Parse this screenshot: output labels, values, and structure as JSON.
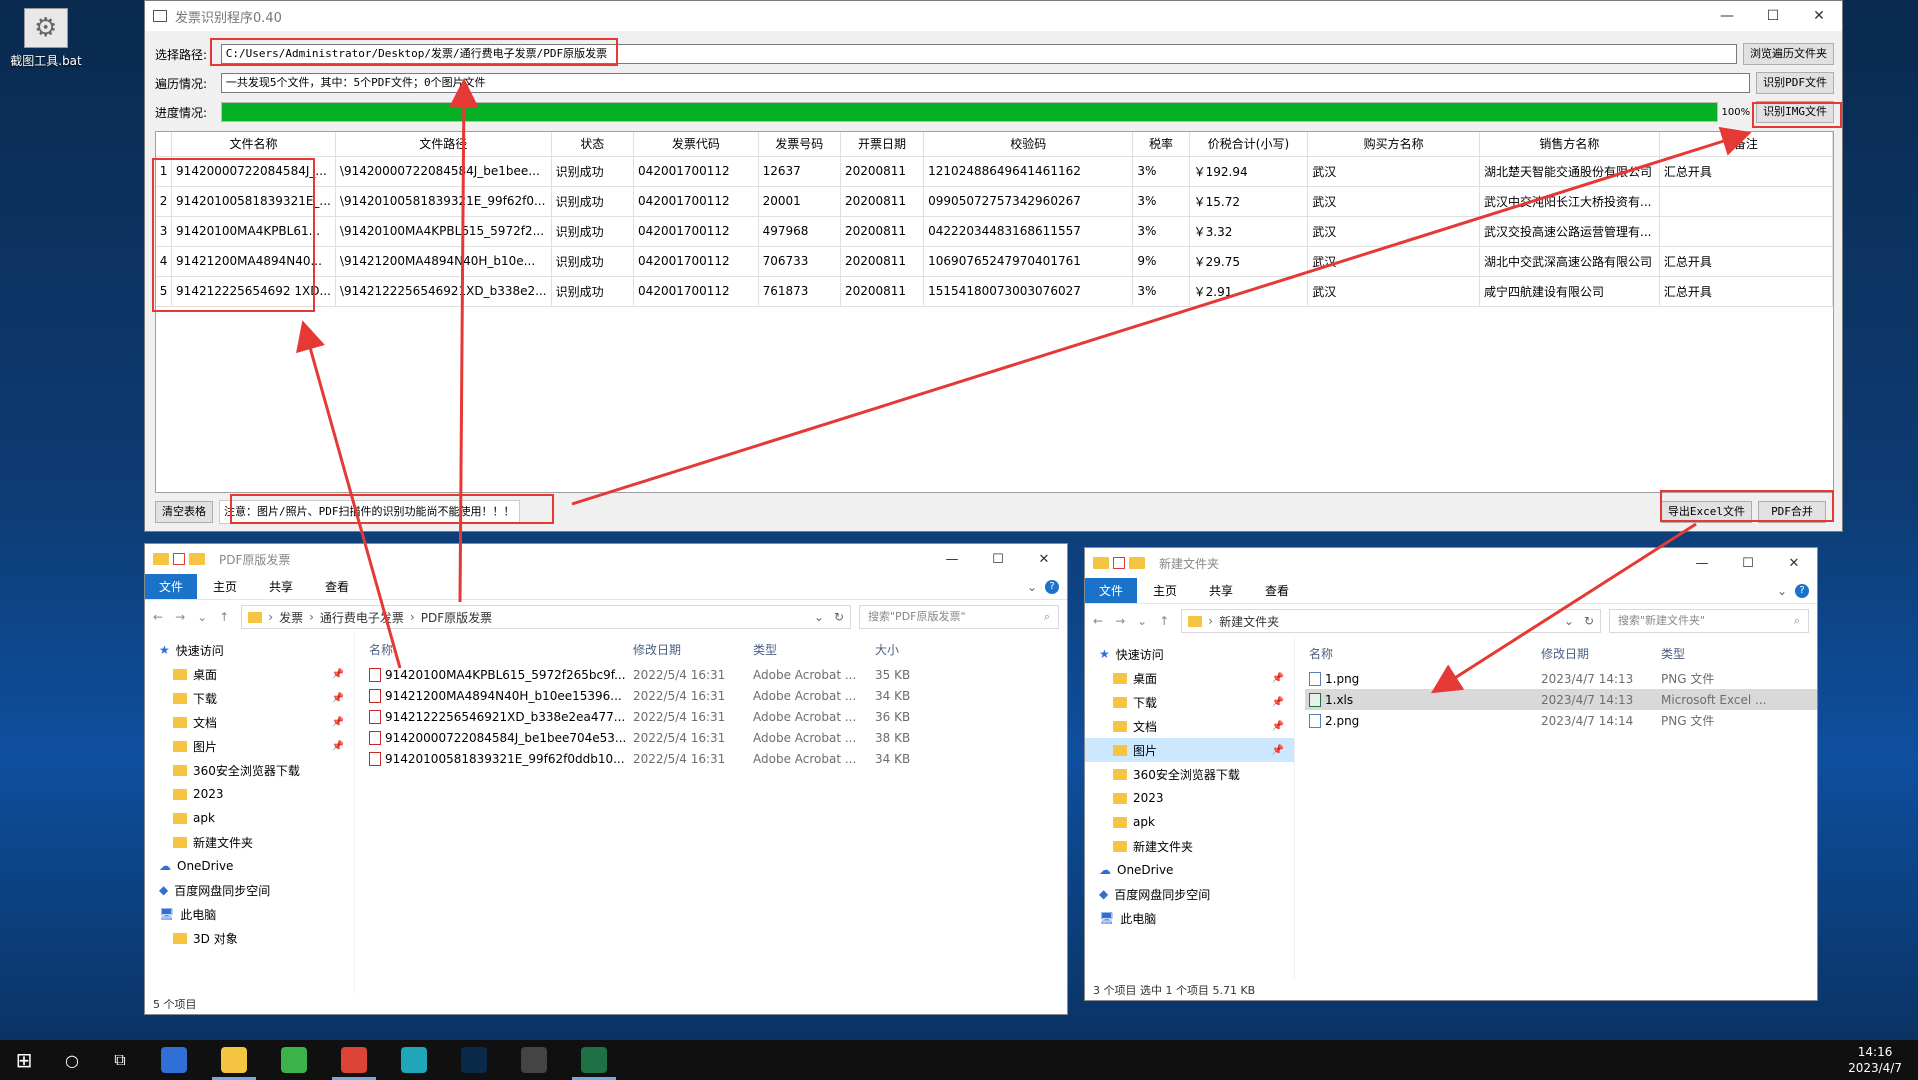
{
  "desktop": {
    "icon_label": "截图工具.bat"
  },
  "app": {
    "title": "发票识别程序0.40",
    "path_label": "选择路径:",
    "path_value": "C:/Users/Administrator/Desktop/发票/通行费电子发票/PDF原版发票",
    "browse_button": "浏览遍历文件夹",
    "scan_label": "遍历情况:",
    "scan_value": "一共发现5个文件，其中：5个PDF文件；0个图片文件",
    "pdf_button": "识别PDF文件",
    "progress_label": "进度情况:",
    "progress_value": 1.0,
    "progress_text": "100%",
    "img_button": "识别IMG文件",
    "columns": [
      "文件名称",
      "文件路径",
      "状态",
      "发票代码",
      "发票号码",
      "开票日期",
      "校验码",
      "税率",
      "价税合计(小写)",
      "购买方名称",
      "销售方名称",
      "备注"
    ],
    "rows": [
      {
        "n": "1",
        "name": "91420000722084584J_...",
        "path": "\\91420000722084584J_be1bee...",
        "status": "识别成功",
        "code": "042001700112",
        "num": "12637",
        "date": "20200811",
        "check": "12102488649641461162",
        "tax": "3%",
        "total": "￥192.94",
        "buyer": "武汉",
        "seller": "湖北楚天智能交通股份有限公司",
        "note": "汇总开具"
      },
      {
        "n": "2",
        "name": "91420100581839321E_...",
        "path": "\\91420100581839321E_99f62f0...",
        "status": "识别成功",
        "code": "042001700112",
        "num": "20001",
        "date": "20200811",
        "check": "09905072757342960267",
        "tax": "3%",
        "total": "￥15.72",
        "buyer": "武汉",
        "seller": "武汉中交沌阳长江大桥投资有...",
        "note": ""
      },
      {
        "n": "3",
        "name": "91420100MA4KPBL61...",
        "path": "\\91420100MA4KPBL615_5972f2...",
        "status": "识别成功",
        "code": "042001700112",
        "num": "497968",
        "date": "20200811",
        "check": "04222034483168611557",
        "tax": "3%",
        "total": "￥3.32",
        "buyer": "武汉",
        "seller": "武汉交投高速公路运营管理有...",
        "note": ""
      },
      {
        "n": "4",
        "name": "91421200MA4894N40...",
        "path": "\\91421200MA4894N40H_b10e...",
        "status": "识别成功",
        "code": "042001700112",
        "num": "706733",
        "date": "20200811",
        "check": "10690765247970401761",
        "tax": "9%",
        "total": "￥29.75",
        "buyer": "武汉",
        "seller": "湖北中交武深高速公路有限公司",
        "note": "汇总开具"
      },
      {
        "n": "5",
        "name": "914212225654692 1XD...",
        "path": "\\9142122256546921XD_b338e2...",
        "status": "识别成功",
        "code": "042001700112",
        "num": "761873",
        "date": "20200811",
        "check": "15154180073003076027",
        "tax": "3%",
        "total": "￥2.91",
        "buyer": "武汉",
        "seller": "咸宁四航建设有限公司",
        "note": "汇总开具"
      }
    ],
    "clear_button": "清空表格",
    "note_text": "注意：图片/照片、PDF扫描件的识别功能尚不能使用！！！",
    "excel_button": "导出Excel文件",
    "merge_button": "PDF合并"
  },
  "explorer1": {
    "title": "PDF原版发票",
    "tabs": [
      "文件",
      "主页",
      "共享",
      "查看"
    ],
    "crumbs": [
      "发票",
      "通行费电子发票",
      "PDF原版发票"
    ],
    "search_placeholder": "搜索\"PDF原版发票\"",
    "nav": [
      {
        "label": "快速访问",
        "head": true
      },
      {
        "label": "桌面",
        "pin": true
      },
      {
        "label": "下载",
        "pin": true
      },
      {
        "label": "文档",
        "pin": true
      },
      {
        "label": "图片",
        "pin": true
      },
      {
        "label": "360安全浏览器下载"
      },
      {
        "label": "2023"
      },
      {
        "label": "apk"
      },
      {
        "label": "新建文件夹"
      },
      {
        "label": "OneDrive",
        "head": true
      },
      {
        "label": "百度网盘同步空间",
        "head": true
      },
      {
        "label": "此电脑",
        "head": true
      },
      {
        "label": "3D 对象"
      }
    ],
    "headers": [
      "名称",
      "修改日期",
      "类型",
      "大小"
    ],
    "files": [
      {
        "name": "91420100MA4KPBL615_5972f265bc9f...",
        "date": "2022/5/4 16:31",
        "type": "Adobe Acrobat ...",
        "size": "35 KB"
      },
      {
        "name": "91421200MA4894N40H_b10ee15396...",
        "date": "2022/5/4 16:31",
        "type": "Adobe Acrobat ...",
        "size": "34 KB"
      },
      {
        "name": "9142122256546921XD_b338e2ea477...",
        "date": "2022/5/4 16:31",
        "type": "Adobe Acrobat ...",
        "size": "36 KB"
      },
      {
        "name": "91420000722084584J_be1bee704e53...",
        "date": "2022/5/4 16:31",
        "type": "Adobe Acrobat ...",
        "size": "38 KB"
      },
      {
        "name": "91420100581839321E_99f62f0ddb10...",
        "date": "2022/5/4 16:31",
        "type": "Adobe Acrobat ...",
        "size": "34 KB"
      }
    ],
    "status": "5 个项目"
  },
  "explorer2": {
    "title": "新建文件夹",
    "tabs": [
      "文件",
      "主页",
      "共享",
      "查看"
    ],
    "crumbs": [
      "新建文件夹"
    ],
    "search_placeholder": "搜索\"新建文件夹\"",
    "nav": [
      {
        "label": "快速访问",
        "head": true
      },
      {
        "label": "桌面",
        "pin": true
      },
      {
        "label": "下载",
        "pin": true
      },
      {
        "label": "文档",
        "pin": true
      },
      {
        "label": "图片",
        "pin": true,
        "sel": true
      },
      {
        "label": "360安全浏览器下载"
      },
      {
        "label": "2023"
      },
      {
        "label": "apk"
      },
      {
        "label": "新建文件夹"
      },
      {
        "label": "OneDrive",
        "head": true
      },
      {
        "label": "百度网盘同步空间",
        "head": true
      },
      {
        "label": "此电脑",
        "head": true
      }
    ],
    "headers": [
      "名称",
      "修改日期",
      "类型"
    ],
    "files": [
      {
        "name": "1.png",
        "date": "2023/4/7 14:13",
        "type": "PNG 文件",
        "kind": "png"
      },
      {
        "name": "1.xls",
        "date": "2023/4/7 14:13",
        "type": "Microsoft Excel ...",
        "kind": "xls",
        "sel": true
      },
      {
        "name": "2.png",
        "date": "2023/4/7 14:14",
        "type": "PNG 文件",
        "kind": "png"
      }
    ],
    "status": "3 个项目    选中 1 个项目  5.71 KB"
  },
  "taskbar": {
    "time": "14:16",
    "date": "2023/4/7",
    "apps": [
      {
        "name": "onedrive-icon",
        "color": "#2f6fd6"
      },
      {
        "name": "file-explorer-icon",
        "color": "#f5c542",
        "active": true
      },
      {
        "name": "browser-360-icon",
        "color": "#3cb34a"
      },
      {
        "name": "chrome-icon",
        "color": "#db4437",
        "active": true
      },
      {
        "name": "app-q-icon",
        "color": "#1fa6b8"
      },
      {
        "name": "photoshop-icon",
        "color": "#0b2a4a"
      },
      {
        "name": "terminal-icon",
        "color": "#444444"
      },
      {
        "name": "excel-icon",
        "color": "#1e7145",
        "active": true
      }
    ]
  },
  "colors": {
    "accent": "#1a73c9",
    "progress": "#06b025",
    "highlight": "#e53935"
  }
}
